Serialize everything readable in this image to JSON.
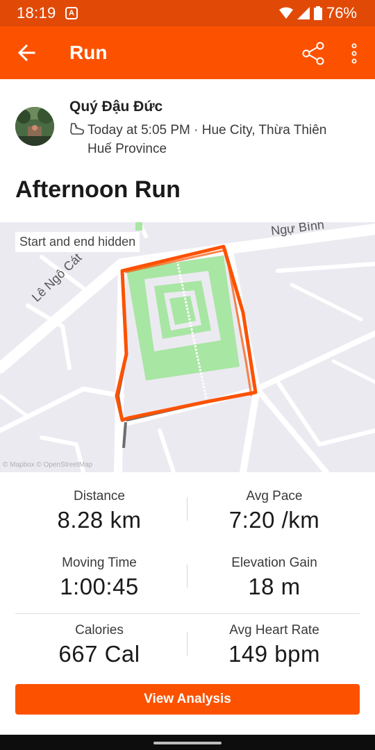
{
  "status_bar": {
    "time": "18:19",
    "app_icon_letter": "A",
    "battery": "76%"
  },
  "app_bar": {
    "title": "Run",
    "back_icon": "arrow-left-icon",
    "share_icon": "share-icon",
    "more_icon": "more-vertical-icon"
  },
  "athlete": {
    "name": "Quý Đậu Đức",
    "meta": "Today at 5:05 PM · Hue City, Thừa Thiên Huế Province"
  },
  "activity": {
    "title": "Afternoon Run"
  },
  "map": {
    "hidden_label": "Start and end hidden",
    "streets": [
      "Ngự Bình",
      "Lê Ngô Cát"
    ],
    "attribution": "© Mapbox © OpenStreetMap",
    "route_color": "#fc5200",
    "park_color": "#a8e6a3"
  },
  "stats": [
    {
      "label": "Distance",
      "value": "8.28 km"
    },
    {
      "label": "Avg Pace",
      "value": "7:20 /km"
    },
    {
      "label": "Moving Time",
      "value": "1:00:45"
    },
    {
      "label": "Elevation Gain",
      "value": "18 m"
    },
    {
      "label": "Calories",
      "value": "667 Cal"
    },
    {
      "label": "Avg Heart Rate",
      "value": "149 bpm"
    }
  ],
  "actions": {
    "view_analysis": "View Analysis"
  },
  "colors": {
    "brand": "#fc5200",
    "status_bar": "#e14a06"
  }
}
